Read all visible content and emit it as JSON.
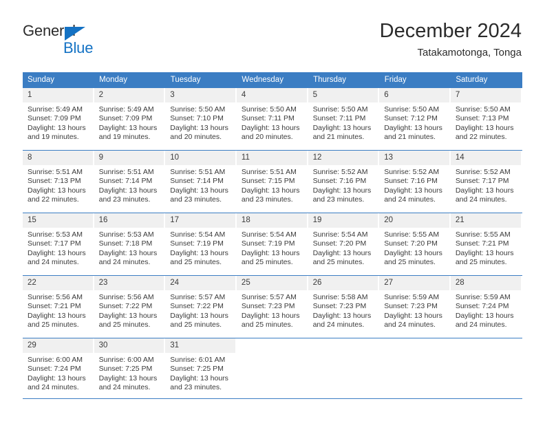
{
  "brand": {
    "name_part1": "General",
    "name_part2": "Blue",
    "accent_color": "#1472c4"
  },
  "header": {
    "title": "December 2024",
    "subtitle": "Tatakamotonga, Tonga"
  },
  "theme": {
    "header_blue": "#3b7dc3",
    "daynum_band": "#f0f0f0",
    "text": "#3a3a3a"
  },
  "weekdays": [
    "Sunday",
    "Monday",
    "Tuesday",
    "Wednesday",
    "Thursday",
    "Friday",
    "Saturday"
  ],
  "labels": {
    "sunrise_prefix": "Sunrise: ",
    "sunset_prefix": "Sunset: ",
    "daylight_prefix": "Daylight: "
  },
  "weeks": [
    [
      {
        "day": "1",
        "sunrise": "Sunrise: 5:49 AM",
        "sunset": "Sunset: 7:09 PM",
        "daylight1": "Daylight: 13 hours",
        "daylight2": "and 19 minutes."
      },
      {
        "day": "2",
        "sunrise": "Sunrise: 5:49 AM",
        "sunset": "Sunset: 7:09 PM",
        "daylight1": "Daylight: 13 hours",
        "daylight2": "and 19 minutes."
      },
      {
        "day": "3",
        "sunrise": "Sunrise: 5:50 AM",
        "sunset": "Sunset: 7:10 PM",
        "daylight1": "Daylight: 13 hours",
        "daylight2": "and 20 minutes."
      },
      {
        "day": "4",
        "sunrise": "Sunrise: 5:50 AM",
        "sunset": "Sunset: 7:11 PM",
        "daylight1": "Daylight: 13 hours",
        "daylight2": "and 20 minutes."
      },
      {
        "day": "5",
        "sunrise": "Sunrise: 5:50 AM",
        "sunset": "Sunset: 7:11 PM",
        "daylight1": "Daylight: 13 hours",
        "daylight2": "and 21 minutes."
      },
      {
        "day": "6",
        "sunrise": "Sunrise: 5:50 AM",
        "sunset": "Sunset: 7:12 PM",
        "daylight1": "Daylight: 13 hours",
        "daylight2": "and 21 minutes."
      },
      {
        "day": "7",
        "sunrise": "Sunrise: 5:50 AM",
        "sunset": "Sunset: 7:13 PM",
        "daylight1": "Daylight: 13 hours",
        "daylight2": "and 22 minutes."
      }
    ],
    [
      {
        "day": "8",
        "sunrise": "Sunrise: 5:51 AM",
        "sunset": "Sunset: 7:13 PM",
        "daylight1": "Daylight: 13 hours",
        "daylight2": "and 22 minutes."
      },
      {
        "day": "9",
        "sunrise": "Sunrise: 5:51 AM",
        "sunset": "Sunset: 7:14 PM",
        "daylight1": "Daylight: 13 hours",
        "daylight2": "and 23 minutes."
      },
      {
        "day": "10",
        "sunrise": "Sunrise: 5:51 AM",
        "sunset": "Sunset: 7:14 PM",
        "daylight1": "Daylight: 13 hours",
        "daylight2": "and 23 minutes."
      },
      {
        "day": "11",
        "sunrise": "Sunrise: 5:51 AM",
        "sunset": "Sunset: 7:15 PM",
        "daylight1": "Daylight: 13 hours",
        "daylight2": "and 23 minutes."
      },
      {
        "day": "12",
        "sunrise": "Sunrise: 5:52 AM",
        "sunset": "Sunset: 7:16 PM",
        "daylight1": "Daylight: 13 hours",
        "daylight2": "and 23 minutes."
      },
      {
        "day": "13",
        "sunrise": "Sunrise: 5:52 AM",
        "sunset": "Sunset: 7:16 PM",
        "daylight1": "Daylight: 13 hours",
        "daylight2": "and 24 minutes."
      },
      {
        "day": "14",
        "sunrise": "Sunrise: 5:52 AM",
        "sunset": "Sunset: 7:17 PM",
        "daylight1": "Daylight: 13 hours",
        "daylight2": "and 24 minutes."
      }
    ],
    [
      {
        "day": "15",
        "sunrise": "Sunrise: 5:53 AM",
        "sunset": "Sunset: 7:17 PM",
        "daylight1": "Daylight: 13 hours",
        "daylight2": "and 24 minutes."
      },
      {
        "day": "16",
        "sunrise": "Sunrise: 5:53 AM",
        "sunset": "Sunset: 7:18 PM",
        "daylight1": "Daylight: 13 hours",
        "daylight2": "and 24 minutes."
      },
      {
        "day": "17",
        "sunrise": "Sunrise: 5:54 AM",
        "sunset": "Sunset: 7:19 PM",
        "daylight1": "Daylight: 13 hours",
        "daylight2": "and 25 minutes."
      },
      {
        "day": "18",
        "sunrise": "Sunrise: 5:54 AM",
        "sunset": "Sunset: 7:19 PM",
        "daylight1": "Daylight: 13 hours",
        "daylight2": "and 25 minutes."
      },
      {
        "day": "19",
        "sunrise": "Sunrise: 5:54 AM",
        "sunset": "Sunset: 7:20 PM",
        "daylight1": "Daylight: 13 hours",
        "daylight2": "and 25 minutes."
      },
      {
        "day": "20",
        "sunrise": "Sunrise: 5:55 AM",
        "sunset": "Sunset: 7:20 PM",
        "daylight1": "Daylight: 13 hours",
        "daylight2": "and 25 minutes."
      },
      {
        "day": "21",
        "sunrise": "Sunrise: 5:55 AM",
        "sunset": "Sunset: 7:21 PM",
        "daylight1": "Daylight: 13 hours",
        "daylight2": "and 25 minutes."
      }
    ],
    [
      {
        "day": "22",
        "sunrise": "Sunrise: 5:56 AM",
        "sunset": "Sunset: 7:21 PM",
        "daylight1": "Daylight: 13 hours",
        "daylight2": "and 25 minutes."
      },
      {
        "day": "23",
        "sunrise": "Sunrise: 5:56 AM",
        "sunset": "Sunset: 7:22 PM",
        "daylight1": "Daylight: 13 hours",
        "daylight2": "and 25 minutes."
      },
      {
        "day": "24",
        "sunrise": "Sunrise: 5:57 AM",
        "sunset": "Sunset: 7:22 PM",
        "daylight1": "Daylight: 13 hours",
        "daylight2": "and 25 minutes."
      },
      {
        "day": "25",
        "sunrise": "Sunrise: 5:57 AM",
        "sunset": "Sunset: 7:23 PM",
        "daylight1": "Daylight: 13 hours",
        "daylight2": "and 25 minutes."
      },
      {
        "day": "26",
        "sunrise": "Sunrise: 5:58 AM",
        "sunset": "Sunset: 7:23 PM",
        "daylight1": "Daylight: 13 hours",
        "daylight2": "and 24 minutes."
      },
      {
        "day": "27",
        "sunrise": "Sunrise: 5:59 AM",
        "sunset": "Sunset: 7:23 PM",
        "daylight1": "Daylight: 13 hours",
        "daylight2": "and 24 minutes."
      },
      {
        "day": "28",
        "sunrise": "Sunrise: 5:59 AM",
        "sunset": "Sunset: 7:24 PM",
        "daylight1": "Daylight: 13 hours",
        "daylight2": "and 24 minutes."
      }
    ],
    [
      {
        "day": "29",
        "sunrise": "Sunrise: 6:00 AM",
        "sunset": "Sunset: 7:24 PM",
        "daylight1": "Daylight: 13 hours",
        "daylight2": "and 24 minutes."
      },
      {
        "day": "30",
        "sunrise": "Sunrise: 6:00 AM",
        "sunset": "Sunset: 7:25 PM",
        "daylight1": "Daylight: 13 hours",
        "daylight2": "and 24 minutes."
      },
      {
        "day": "31",
        "sunrise": "Sunrise: 6:01 AM",
        "sunset": "Sunset: 7:25 PM",
        "daylight1": "Daylight: 13 hours",
        "daylight2": "and 23 minutes."
      },
      {
        "day": "",
        "sunrise": "",
        "sunset": "",
        "daylight1": "",
        "daylight2": ""
      },
      {
        "day": "",
        "sunrise": "",
        "sunset": "",
        "daylight1": "",
        "daylight2": ""
      },
      {
        "day": "",
        "sunrise": "",
        "sunset": "",
        "daylight1": "",
        "daylight2": ""
      },
      {
        "day": "",
        "sunrise": "",
        "sunset": "",
        "daylight1": "",
        "daylight2": ""
      }
    ]
  ]
}
